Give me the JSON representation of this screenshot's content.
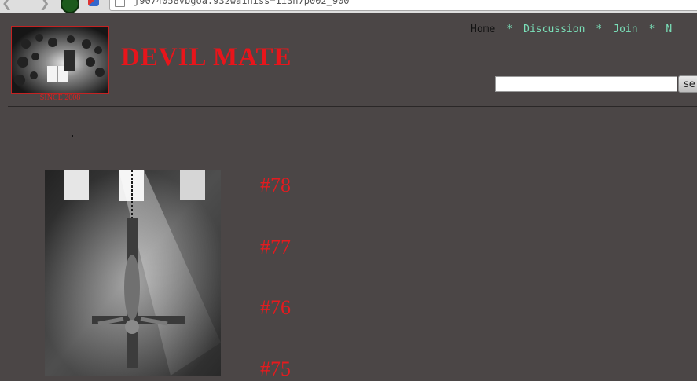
{
  "browser": {
    "url_fragment": "j9074058vbgoa.932wa1hiss=1i3n7p002_900"
  },
  "header": {
    "since": "SINCE 2008",
    "title": "DEVIL MATE"
  },
  "nav": {
    "items": [
      {
        "label": "Home"
      },
      {
        "label": "Discussion"
      },
      {
        "label": "Join"
      },
      {
        "label": "N"
      }
    ],
    "separator": "*"
  },
  "search": {
    "value": "",
    "button_label": "se"
  },
  "posts": [
    {
      "label": "#78"
    },
    {
      "label": "#77"
    },
    {
      "label": "#76"
    },
    {
      "label": "#75"
    }
  ],
  "colors": {
    "background": "#4b4646",
    "title_red": "#e8151b",
    "nav_teal": "#7ae0b9"
  }
}
